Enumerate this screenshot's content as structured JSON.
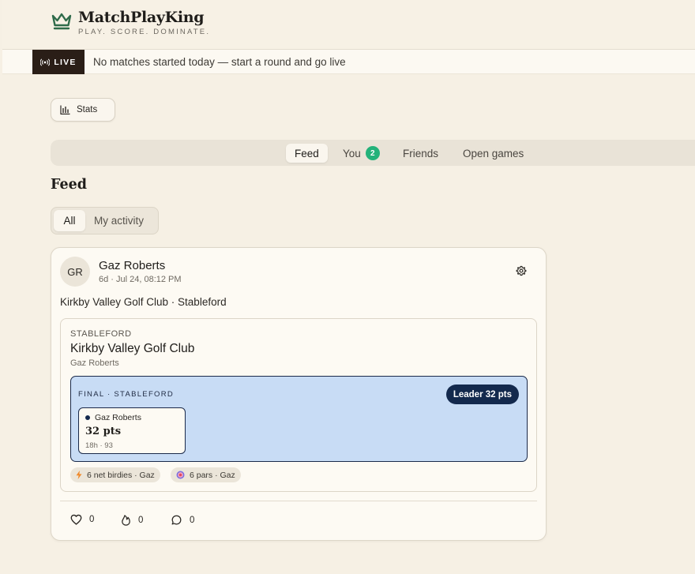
{
  "brand": {
    "name": "MatchPlayKing",
    "tagline": "PLAY. SCORE. DOMINATE.",
    "accent": "#2f6b4a"
  },
  "live": {
    "badge": "LIVE",
    "message": "No matches started today — start a round and go live"
  },
  "stats_button": {
    "label": "Stats",
    "icon": "bar-chart-icon"
  },
  "tabs": [
    {
      "label": "Feed",
      "active": true
    },
    {
      "label": "You",
      "count": "2"
    },
    {
      "label": "Friends"
    },
    {
      "label": "Open games"
    }
  ],
  "feed": {
    "title": "Feed",
    "filters": {
      "all": "All",
      "mine": "My activity",
      "selected": "All"
    }
  },
  "post": {
    "avatar_initials": "GR",
    "author": "Gaz Roberts",
    "timestamp": "6d · Jul 24, 08:12 PM",
    "summary": "Kirkby Valley Golf Club · Stableford",
    "round": {
      "format": "STABLEFORD",
      "club": "Kirkby Valley Golf Club",
      "player": "Gaz Roberts",
      "result_label": "FINAL · STABLEFORD",
      "leader_label": "Leader 32 pts",
      "score_card": {
        "player": "Gaz Roberts",
        "points": "32 pts",
        "meta": "18h · 93"
      },
      "highlights": [
        {
          "icon": "lightning-icon",
          "text": "6 net birdies · Gaz"
        },
        {
          "icon": "target-icon",
          "text": "6 pars · Gaz"
        }
      ]
    },
    "reactions": [
      {
        "icon": "heart-icon",
        "count": "0"
      },
      {
        "icon": "flame-icon",
        "count": "0"
      },
      {
        "icon": "comment-icon",
        "count": "0"
      }
    ]
  },
  "colors": {
    "background": "#f6f0e4",
    "live_badge": "#2a1e17",
    "tab_count": "#23b27a",
    "result_bg": "#c8dcf5",
    "leader_bg": "#13294d"
  }
}
